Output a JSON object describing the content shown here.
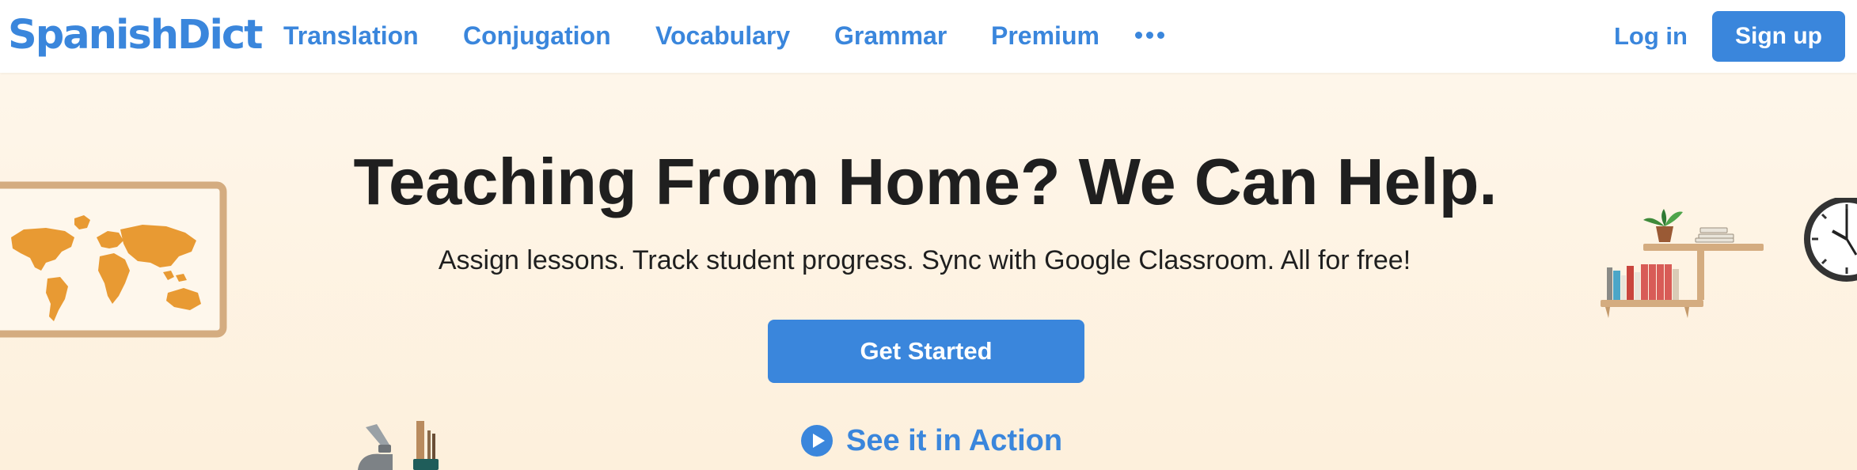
{
  "brand": {
    "logo_text": "SpanishDict"
  },
  "nav": {
    "links": [
      {
        "label": "Translation"
      },
      {
        "label": "Conjugation"
      },
      {
        "label": "Vocabulary"
      },
      {
        "label": "Grammar"
      },
      {
        "label": "Premium"
      }
    ],
    "more_icon": "more-horizontal-icon",
    "login_label": "Log in",
    "signup_label": "Sign up"
  },
  "hero": {
    "headline": "Teaching From Home? We Can Help.",
    "subheadline": "Assign lessons. Track student progress. Sync with Google Classroom. All for free!",
    "cta_label": "Get Started",
    "secondary_label": "See it in Action",
    "secondary_icon": "play-circle-icon"
  },
  "illustrations": [
    "world-map-board-icon",
    "bookshelf-icon",
    "wall-clock-icon",
    "microscope-icon",
    "pencil-cup-icon"
  ],
  "colors": {
    "brand_blue": "#3a86dc",
    "text_dark": "#1f1f1f",
    "hero_bg": "#fef6ea",
    "map_orange": "#e89a33",
    "wood": "#d4ac80"
  }
}
